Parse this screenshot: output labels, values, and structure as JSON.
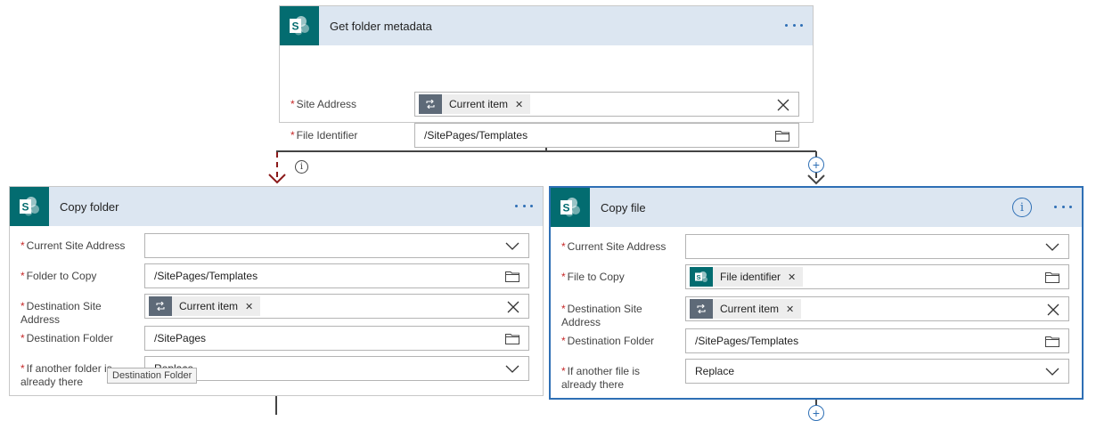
{
  "top_card": {
    "title": "Get folder metadata",
    "fields": {
      "site_address": {
        "label": "Site Address",
        "token": "Current item"
      },
      "file_identifier": {
        "label": "File Identifier",
        "value": "/SitePages/Templates"
      }
    }
  },
  "copy_folder": {
    "title": "Copy folder",
    "fields": {
      "current_site_address": {
        "label": "Current Site Address",
        "value": ""
      },
      "folder_to_copy": {
        "label": "Folder to Copy",
        "value": "/SitePages/Templates"
      },
      "destination_site_address": {
        "label_line1": "Destination Site",
        "label_line2": "Address",
        "token": "Current item"
      },
      "destination_folder": {
        "label": "Destination Folder",
        "value": "/SitePages"
      },
      "if_another": {
        "label_line1": "If another folder is",
        "label_line2": "already there",
        "value": "Replace"
      }
    },
    "tooltip": "Destination Folder"
  },
  "copy_file": {
    "title": "Copy file",
    "fields": {
      "current_site_address": {
        "label": "Current Site Address",
        "value": ""
      },
      "file_to_copy": {
        "label": "File to Copy",
        "token": "File identifier"
      },
      "destination_site_address": {
        "label_line1": "Destination Site",
        "label_line2": "Address",
        "token": "Current item"
      },
      "destination_folder": {
        "label": "Destination Folder",
        "value": "/SitePages/Templates"
      },
      "if_another": {
        "label_line1": "If another file is",
        "label_line2": "already there",
        "value": "Replace"
      }
    }
  },
  "icons": {
    "card_logo": "sharepoint-logo-icon",
    "token_loop": "loop-icon",
    "clear": "close-icon",
    "folder": "folder-icon",
    "dropdown": "chevron-down-icon",
    "add": "plus-circle-icon",
    "info": "info-icon",
    "menu": "more-options-icon"
  },
  "colors": {
    "header_bg": "#dce6f1",
    "sharepoint": "#036c70",
    "accent": "#2e6fb5",
    "required": "#c62828",
    "branch_error": "#8b1a1a"
  }
}
